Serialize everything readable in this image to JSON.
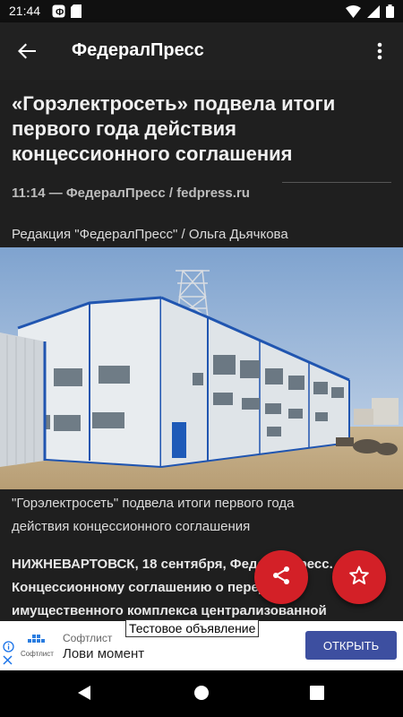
{
  "status_bar": {
    "time": "21:44",
    "icons": [
      "app-notification-icon",
      "sd-card-icon",
      "wifi-icon",
      "signal-icon",
      "battery-icon"
    ]
  },
  "app_bar": {
    "title": "ФедералПресс",
    "back_icon": "arrow-back-icon",
    "menu_icon": "more-vert-icon"
  },
  "article": {
    "headline_lines": [
      "«Горэлектросеть» подвела итоги",
      "первого года действия",
      "концессионного соглашения"
    ],
    "meta": "11:14 — ФедералПресс / fedpress.ru",
    "authors": "Редакция \"ФедералПресс\" / Ольга Дьячкова",
    "image_description_icon": "industrial-building-photo",
    "caption_lines": [
      "\"Горэлектросеть\" подвела итоги первого года",
      "действия концессионного соглашения"
    ],
    "body_lines": [
      "НИЖНЕВАРТОВСК, 18 сентября, ФедералПресс.",
      "Концессионному соглашению о передаче",
      "имущественного комплекса централизованной"
    ]
  },
  "fabs": {
    "share_icon": "share-icon",
    "favorite_icon": "star-outline-icon"
  },
  "ad": {
    "label": "Тестовое объявление",
    "advertiser": "Софтлист",
    "logo_text": "Софтлист",
    "slogan": "Лови момент",
    "button": "ОТКРЫТЬ"
  },
  "nav_bar": {
    "icons": [
      "nav-back-icon",
      "nav-home-icon",
      "nav-recents-icon"
    ]
  },
  "colors": {
    "accent": "#d32027",
    "ad_button": "#3d4fa0",
    "app_bar": "#212121",
    "background": "#1f1f1f"
  }
}
